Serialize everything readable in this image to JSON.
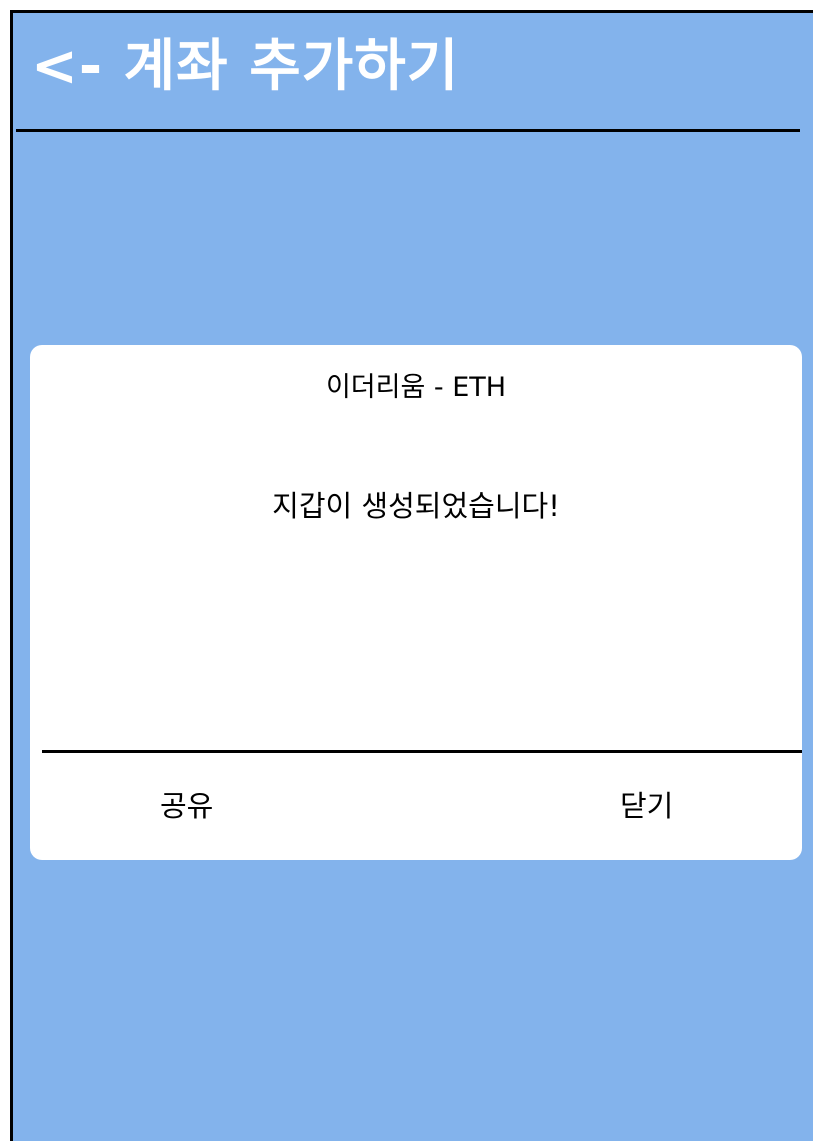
{
  "header": {
    "title": "<- 계좌 추가하기"
  },
  "dialog": {
    "title": "이더리움 - ETH",
    "message": "지갑이 생성되었습니다!",
    "share_label": "공유",
    "close_label": "닫기"
  },
  "colors": {
    "background": "#83b3ec",
    "dialog_background": "#ffffff",
    "header_text": "#ffffff",
    "divider": "#000000"
  }
}
